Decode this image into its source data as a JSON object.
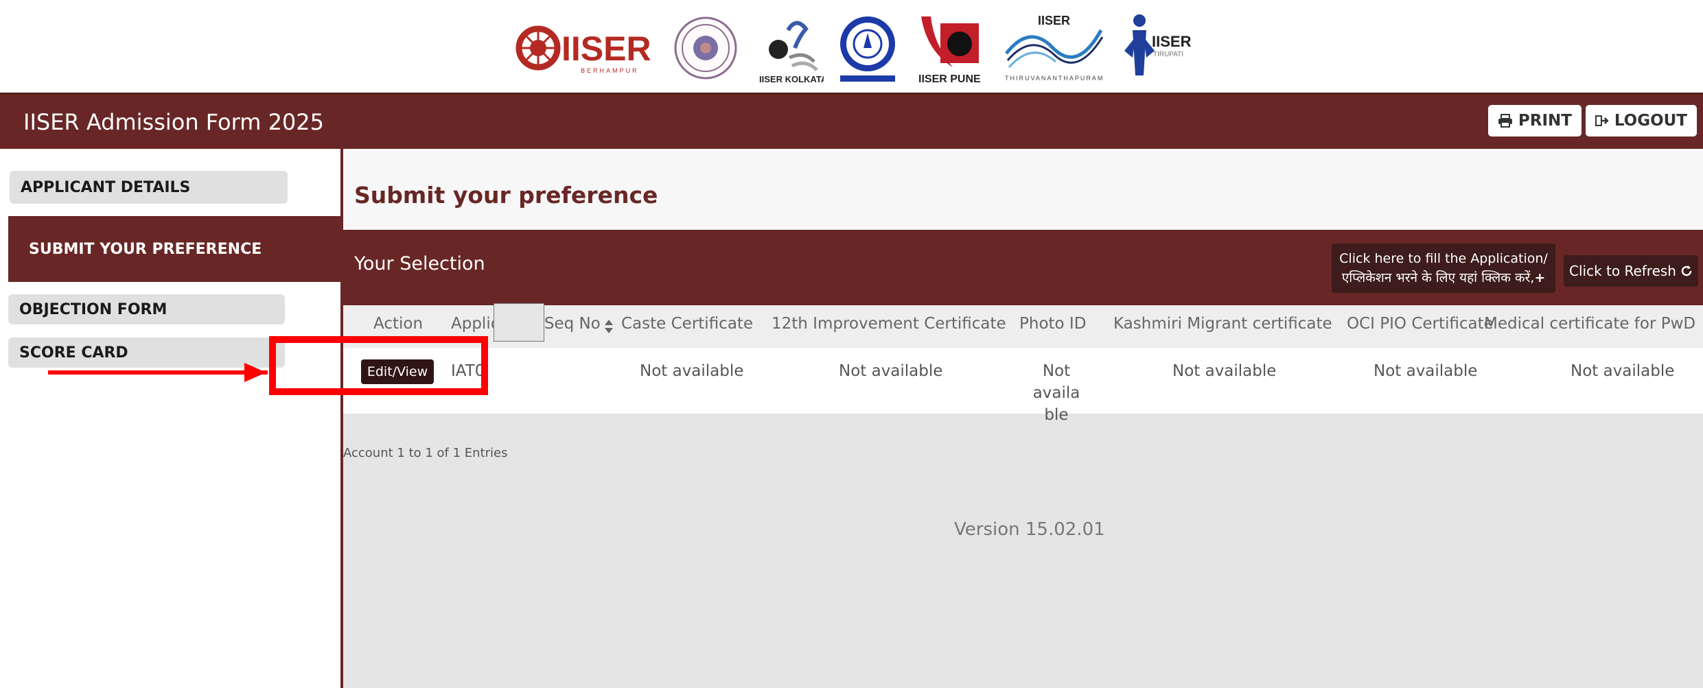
{
  "logos": {
    "gorakhpur_text": "IISER",
    "gorakhpur_sub": "BERHAMPUR",
    "kolkata_caption": "IISER KOLKATA",
    "pune_caption": "IISER PUNE",
    "tvm_caption_top": "IISER",
    "tvm_caption_bottom": "THIRUVANANTHAPURAM",
    "tirupati_caption_top": "IISER",
    "tirupati_caption_bottom": "TIRUPATI"
  },
  "header": {
    "title": "IISER Admission Form 2025",
    "print_label": "PRINT",
    "logout_label": "LOGOUT"
  },
  "sidebar": {
    "items": [
      {
        "label": "APPLICANT DETAILS"
      },
      {
        "label": "SUBMIT YOUR PREFERENCE"
      },
      {
        "label": "OBJECTION FORM"
      },
      {
        "label": "SCORE CARD"
      }
    ]
  },
  "main": {
    "page_title": "Submit your preference",
    "selection_title": "Your Selection",
    "fill_app_line1": "Click here to fill the Application/",
    "fill_app_line2": "एप्लिकेशन भरने के लिए यहां क्लिक करें,",
    "refresh_label": "Click to Refresh",
    "columns": [
      "Action",
      "Application Seq No",
      "Caste Certificate",
      "12th Improvement Certificate",
      "Photo ID",
      "Kashmiri Migrant certificate",
      "OCI PIO Certificate",
      "Medical certificate for PwD"
    ],
    "row": {
      "action_label": "Edit/View",
      "seq_no": "IAT0",
      "caste": "Not available",
      "improvement": "Not available",
      "photo_id_1": "Not availa",
      "photo_id_2": "ble",
      "kashmiri": "Not available",
      "oci": "Not available",
      "medical": "Not available"
    },
    "entries_text": "Account 1  to 1  of 1 Entries",
    "version_text": "Version 15.02.01"
  },
  "colors": {
    "brand": "#682726",
    "brand_dark": "#3d1c1b",
    "annotation": "#ff0000"
  }
}
